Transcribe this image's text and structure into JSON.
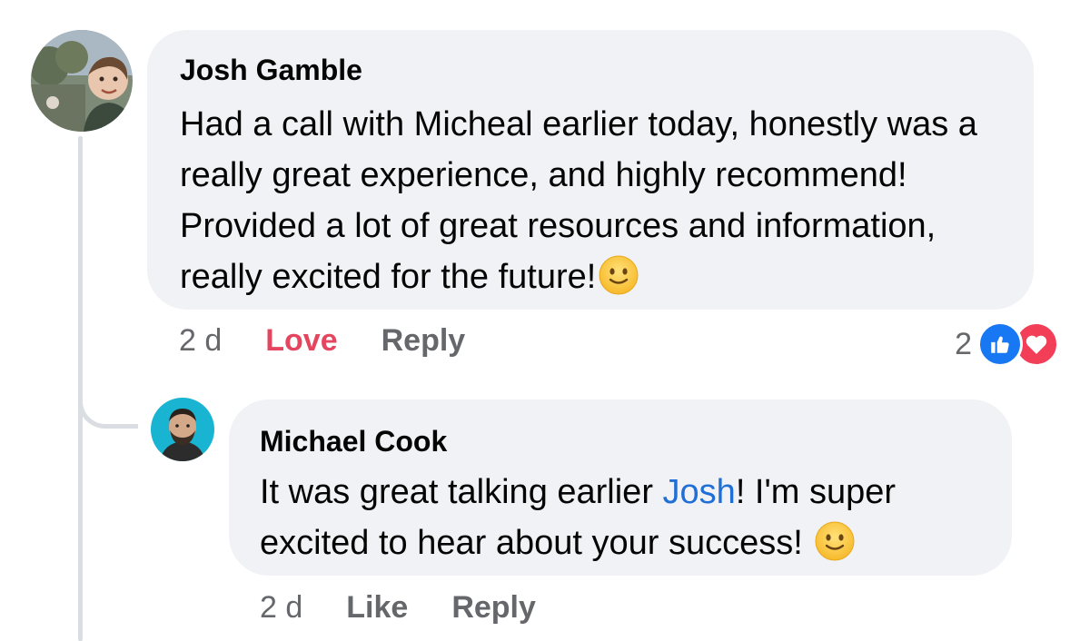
{
  "comment": {
    "author": "Josh Gamble",
    "text": "Had a call with Micheal earlier today, honestly was a really great experience, and highly recommend! Provided a lot of great resources and information, really excited for the future!",
    "emoji": "slightly-smiling-face",
    "time": "2 d",
    "love_label": "Love",
    "reply_label": "Reply",
    "reaction_count": "2",
    "reactions": [
      "like-icon",
      "heart-icon"
    ]
  },
  "reply": {
    "author": "Michael Cook",
    "text_before": "It was great talking earlier ",
    "mention": "Josh",
    "text_after": "! I'm super excited to hear about your success! ",
    "emoji": "slightly-smiling-face",
    "time": "2 d",
    "like_label": "Like",
    "reply_label": "Reply"
  },
  "colors": {
    "bubble": "#f0f2f5",
    "mention": "#1f6fd6",
    "love": "#e4455f",
    "like_reaction": "#1877f2",
    "heart_reaction": "#f33e58",
    "meta": "#65676b"
  }
}
